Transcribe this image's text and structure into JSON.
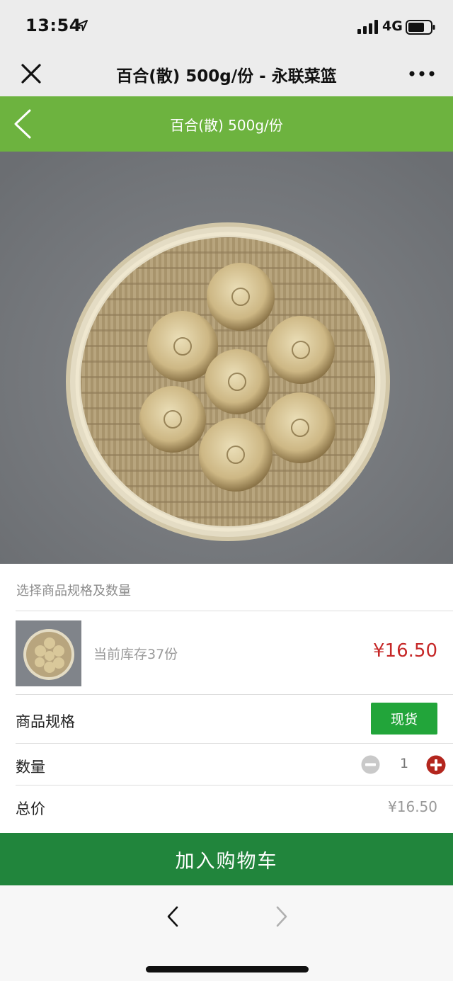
{
  "status": {
    "time": "13:54",
    "network": "4G"
  },
  "wechat_nav": {
    "title": "百合(散) 500g/份 - 永联菜篮"
  },
  "header": {
    "title": "百合(散) 500g/份",
    "accent_color": "#6db33f"
  },
  "product": {
    "image_icon": "lily-bulbs-on-bamboo-tray",
    "spec_prompt": "选择商品规格及数量",
    "stock_text": "当前库存37份",
    "price": "¥16.50"
  },
  "spec": {
    "label": "商品规格",
    "option": "现货"
  },
  "quantity": {
    "label": "数量",
    "value": "1"
  },
  "total": {
    "label": "总价",
    "value": "¥16.50"
  },
  "actions": {
    "add_to_cart": "加入购物车",
    "button_color": "#21853c"
  }
}
